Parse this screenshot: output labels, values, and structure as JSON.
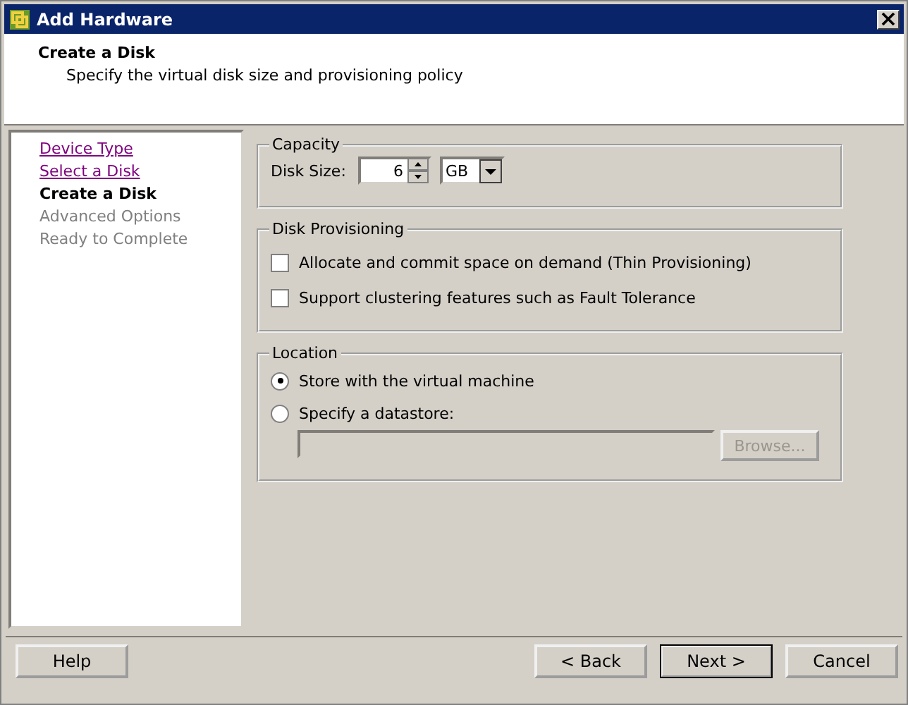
{
  "window": {
    "title": "Add Hardware"
  },
  "header": {
    "title": "Create a Disk",
    "subtitle": "Specify the virtual disk size and provisioning policy"
  },
  "steps": [
    {
      "label": "Device Type",
      "kind": "visited"
    },
    {
      "label": "Select a Disk",
      "kind": "visited"
    },
    {
      "label": "Create a Disk",
      "kind": "current"
    },
    {
      "label": "Advanced Options",
      "kind": "pending"
    },
    {
      "label": "Ready to Complete",
      "kind": "pending"
    }
  ],
  "capacity": {
    "legend": "Capacity",
    "label": "Disk Size:",
    "value": "6",
    "unit": "GB"
  },
  "provisioning": {
    "legend": "Disk Provisioning",
    "options": [
      {
        "label": "Allocate and commit space on demand (Thin Provisioning)",
        "checked": false
      },
      {
        "label": "Support clustering features such as Fault Tolerance",
        "checked": false
      }
    ]
  },
  "location": {
    "legend": "Location",
    "options": [
      {
        "label": "Store with the virtual machine",
        "selected": true
      },
      {
        "label": "Specify a datastore:",
        "selected": false
      }
    ],
    "datastore_field": {
      "disabled": true
    },
    "browse": {
      "label": "Browse...",
      "disabled": true
    }
  },
  "help_button": "Help",
  "nav_buttons": [
    {
      "label": "< Back",
      "default": false
    },
    {
      "label": "Next >",
      "default": true
    },
    {
      "label": "Cancel",
      "default": false
    }
  ]
}
